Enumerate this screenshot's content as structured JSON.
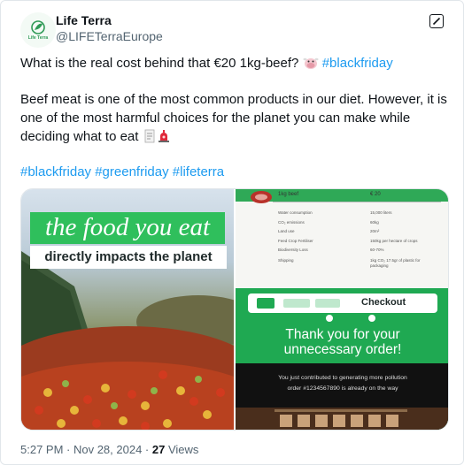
{
  "author": {
    "name": "Life Terra",
    "handle": "@LIFETerraEurope",
    "avatar_text": "Life Terra"
  },
  "tweet": {
    "line1_text": "What is the real cost behind that €20 1kg-beef? ",
    "line1_tag": "#blackfriday",
    "para2_line1": "Beef meat is one of the most common products in our diet. However, it is",
    "para2_line2": "one of the most harmful choices for the planet you can make while",
    "para2_line3": "deciding what to eat ",
    "tags": [
      "#blackfriday",
      "#greenfriday",
      "#lifeterra"
    ]
  },
  "media": {
    "left": {
      "title": "the food you eat",
      "subtitle": "directly impacts the planet"
    },
    "receipt": {
      "item": "1kg beef",
      "price": "€ 20",
      "rows": [
        {
          "label": "Water consumption",
          "value": "15,000 liters"
        },
        {
          "label": "CO₂ emissions",
          "value": "60kg"
        },
        {
          "label": "Land use",
          "value": "20m²"
        },
        {
          "label": "Feed Crop Fertiliser",
          "value": "150kg per hectare of crops"
        },
        {
          "label": "Biodiversity Loss",
          "value": "60-70%"
        },
        {
          "label": "Shipping",
          "value": "1kg CO₂ 17.5gr of plastic for packaging"
        }
      ]
    },
    "checkout": {
      "label": "Checkout",
      "thanks_line1": "Thank you for your",
      "thanks_line2": "unnecessary order!",
      "info_line1": "You just contributed to generating more pollution",
      "info_line2": "order #1234567890 is already on the way"
    }
  },
  "meta": {
    "time": "5:27 PM · Nov 28, 2024 · ",
    "views_count": "27",
    "views_label": " Views"
  },
  "colors": {
    "link": "#1d9bf0",
    "green": "#2fbf5c",
    "dark_green": "#1f6e3b"
  }
}
